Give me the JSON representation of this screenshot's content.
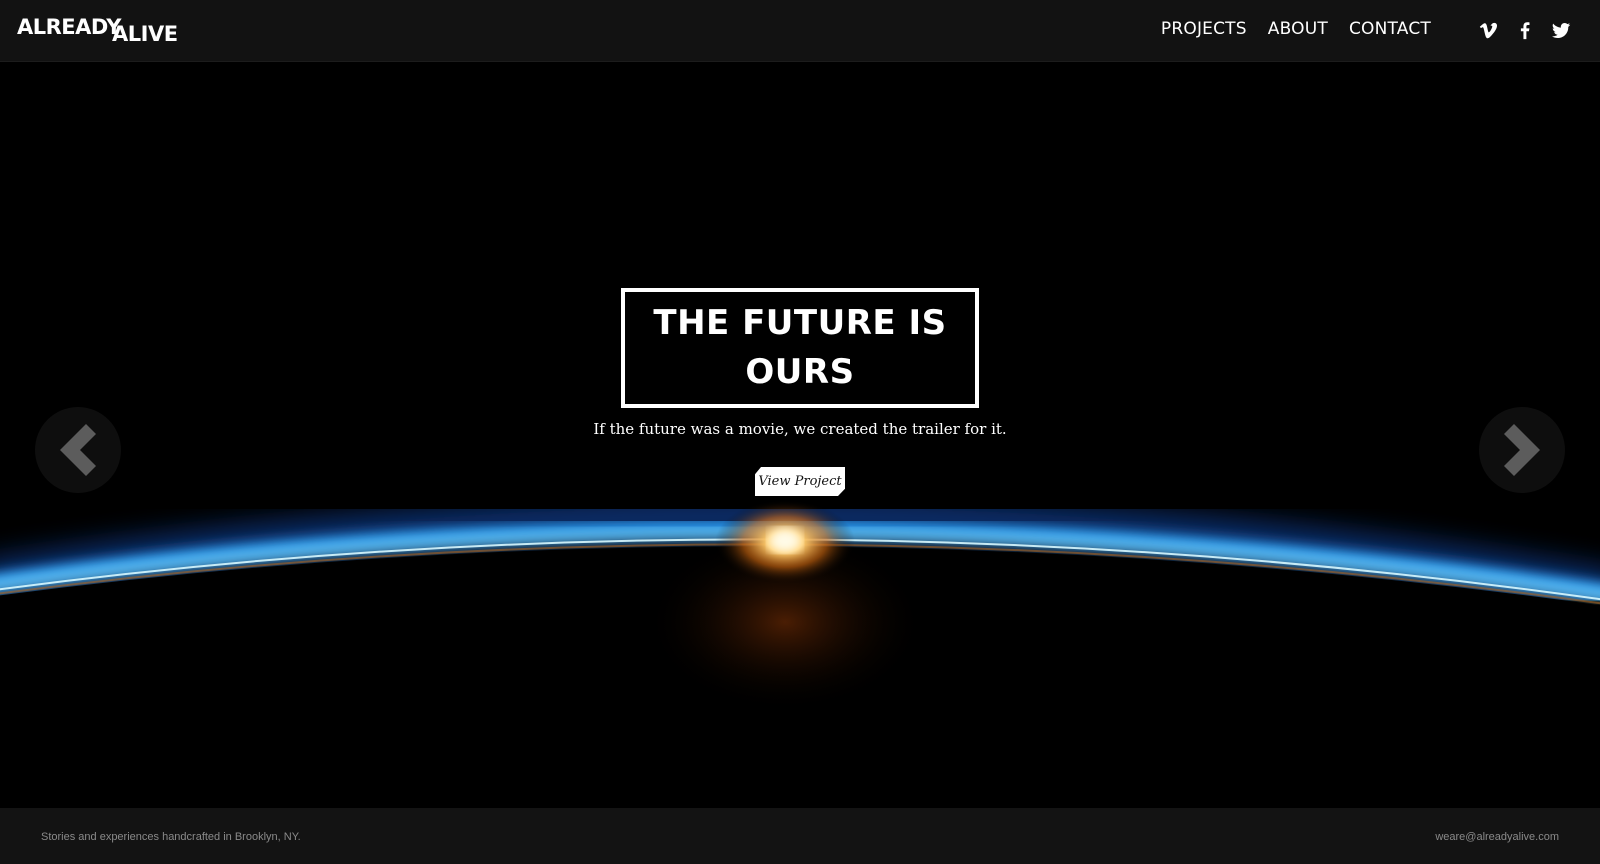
{
  "header": {
    "logo_word1": "ALREADY",
    "logo_word2": "ALIVE",
    "nav": [
      {
        "label": "PROJECTS"
      },
      {
        "label": "ABOUT"
      },
      {
        "label": "CONTACT"
      }
    ],
    "social": [
      {
        "icon": "vimeo-icon"
      },
      {
        "icon": "facebook-icon"
      },
      {
        "icon": "twitter-icon"
      }
    ]
  },
  "hero": {
    "title": "THE FUTURE IS OURS",
    "subtitle": "If the future was a movie, we created the trailer for it.",
    "cta_label": "View Project",
    "prev_icon": "chevron-left-icon",
    "next_icon": "chevron-right-icon"
  },
  "footer": {
    "tagline": "Stories and experiences handcrafted in Brooklyn, NY.",
    "email": "weare@alreadyalive.com"
  },
  "colors": {
    "header_bg": "#121212",
    "footer_bg": "#131313",
    "horizon_blue": "#2a9df4",
    "sun_orange": "#ffb347"
  }
}
